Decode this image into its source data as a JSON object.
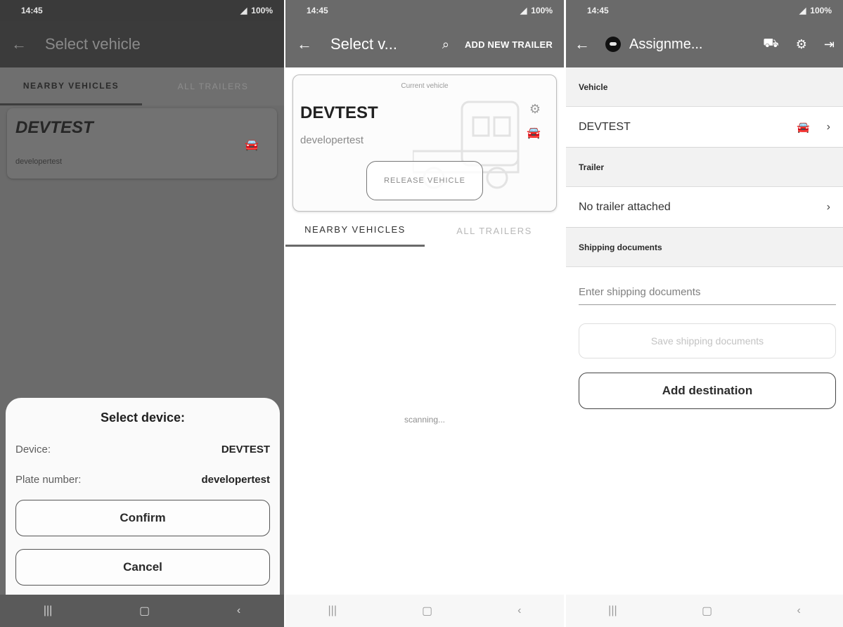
{
  "screen1": {
    "status": {
      "time": "14:45",
      "battery": "100%"
    },
    "appbar": {
      "title": "Select vehicle"
    },
    "tabs": [
      "NEARBY VEHICLES",
      "ALL TRAILERS"
    ],
    "vehicle": {
      "name": "DEVTEST",
      "plate": "developertest"
    },
    "dialog": {
      "title": "Select device:",
      "device_label": "Device:",
      "device_value": "DEVTEST",
      "plate_label": "Plate number:",
      "plate_value": "developertest",
      "confirm": "Confirm",
      "cancel": "Cancel"
    }
  },
  "screen2": {
    "status": {
      "time": "14:45",
      "battery": "100%"
    },
    "appbar": {
      "title": "Select v...",
      "action": "ADD NEW TRAILER"
    },
    "current": {
      "caption": "Current vehicle",
      "name": "DEVTEST",
      "plate": "developertest",
      "release": "RELEASE VEHICLE"
    },
    "tabs": [
      "NEARBY VEHICLES",
      "ALL TRAILERS"
    ],
    "scanning": "scanning..."
  },
  "screen3": {
    "status": {
      "time": "14:45",
      "battery": "100%"
    },
    "appbar": {
      "title": "Assignme..."
    },
    "vehicle_header": "Vehicle",
    "vehicle_value": "DEVTEST",
    "trailer_header": "Trailer",
    "trailer_value": "No trailer attached",
    "shipping_header": "Shipping documents",
    "shipping_placeholder": "Enter shipping documents",
    "save_label": "Save shipping documents",
    "add_destination": "Add destination"
  },
  "icons": {
    "back": "arrow-left",
    "search": "magnifier",
    "gear": "settings",
    "car": "vehicle",
    "chevron": "chevron-right",
    "trucks": "truck-fleet",
    "logout": "logout",
    "nav_recent": "recent-apps",
    "nav_home": "home",
    "nav_back": "back"
  }
}
